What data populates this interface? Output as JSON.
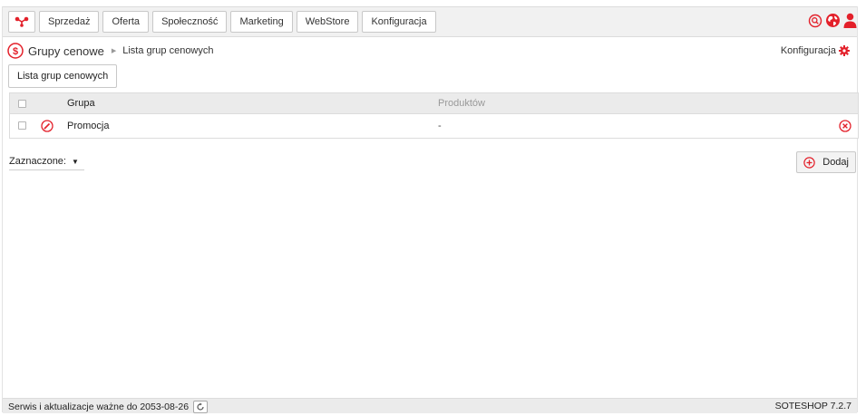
{
  "colors": {
    "accent": "#e3202a",
    "header_bg": "#ebebeb"
  },
  "topnav": {
    "logo_icon": "network-nodes-icon",
    "items": [
      {
        "label": "Sprzedaż"
      },
      {
        "label": "Oferta"
      },
      {
        "label": "Społeczność"
      },
      {
        "label": "Marketing"
      },
      {
        "label": "WebStore"
      },
      {
        "label": "Konfiguracja"
      }
    ],
    "right_icons": [
      "search-icon",
      "globe-icon",
      "user-icon"
    ]
  },
  "breadcrumb": {
    "section_icon": "dollar-circle-icon",
    "section": "Grupy cenowe",
    "separator": "▶",
    "current": "Lista grup cenowych"
  },
  "config_link": {
    "label": "Konfiguracja",
    "icon": "gear-icon"
  },
  "list_button": {
    "label": "Lista grup cenowych"
  },
  "table": {
    "columns": [
      "Grupa",
      "Produktów"
    ],
    "rows": [
      {
        "grupa": "Promocja",
        "produktow": "-"
      }
    ]
  },
  "bulk_select": {
    "label": "Zaznaczone:",
    "arrow": "▼"
  },
  "add_button": {
    "label": "Dodaj",
    "icon": "plus-circle-icon"
  },
  "footer": {
    "license": "Serwis i aktualizacje ważne do 2053-08-26",
    "version": "SOTESHOP 7.2.7"
  }
}
